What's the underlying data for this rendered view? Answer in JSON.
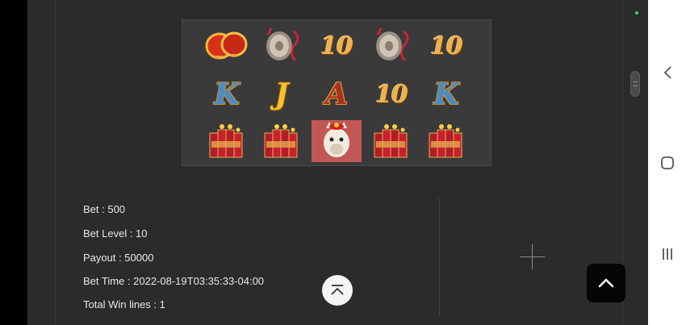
{
  "reels": {
    "rows": [
      [
        {
          "icon": "lantern-symbol",
          "text": ""
        },
        {
          "icon": "gong-symbol",
          "text": ""
        },
        {
          "icon": "ten-symbol",
          "text": "10"
        },
        {
          "icon": "gong-symbol",
          "text": ""
        },
        {
          "icon": "ten-symbol",
          "text": "10"
        }
      ],
      [
        {
          "icon": "king-symbol",
          "text": "K"
        },
        {
          "icon": "jack-symbol",
          "text": "J"
        },
        {
          "icon": "ace-symbol",
          "text": "A"
        },
        {
          "icon": "ten-symbol",
          "text": "10"
        },
        {
          "icon": "king-symbol",
          "text": "K"
        }
      ],
      [
        {
          "icon": "firecracker-symbol",
          "text": ""
        },
        {
          "icon": "firecracker-symbol",
          "text": ""
        },
        {
          "icon": "alpaca-wild-symbol",
          "text": ""
        },
        {
          "icon": "firecracker-symbol",
          "text": ""
        },
        {
          "icon": "firecracker-symbol",
          "text": ""
        }
      ]
    ]
  },
  "details": {
    "bet": "Bet : 500",
    "bet_level": "Bet Level : 10",
    "payout": "Payout : 50000",
    "bet_time": "Bet Time : 2022-08-19T03:35:33-04:00",
    "total_win_lines": "Total Win lines : 1"
  },
  "icons": {
    "expand": "plus-icon",
    "collapse": "chevron-up-bar-icon",
    "scroll_top": "chevron-up-icon",
    "nav_back": "back-icon",
    "nav_home": "home-icon",
    "nav_recent": "recent-apps-icon"
  },
  "colors": {
    "background": "#2b2b2b",
    "reel_background": "#3a3a3a",
    "text": "#e8e8e8",
    "status_dot": "#39d353"
  }
}
